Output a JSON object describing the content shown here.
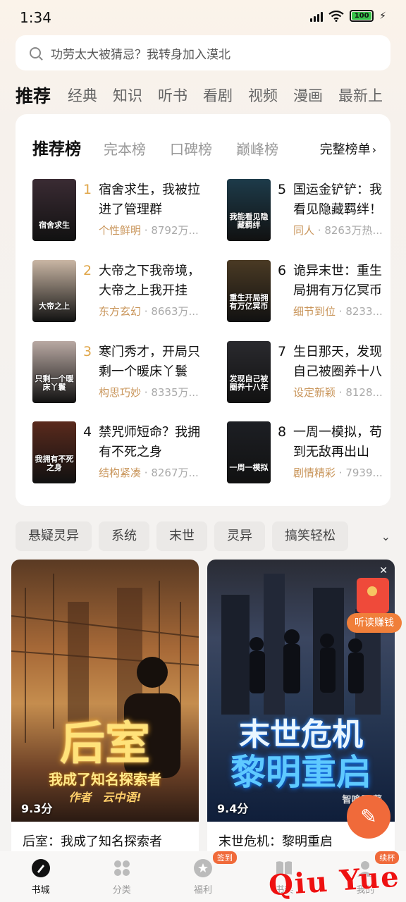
{
  "status": {
    "time": "1:34",
    "battery": "100"
  },
  "search": {
    "placeholder": "功劳太大被猜忌？我转身加入漠北"
  },
  "top_tabs": [
    "推荐",
    "经典",
    "知识",
    "听书",
    "看剧",
    "视频",
    "漫画",
    "最新上"
  ],
  "ranking": {
    "tabs": [
      "推荐榜",
      "完本榜",
      "口碑榜",
      "巅峰榜"
    ],
    "full_list": "完整榜单",
    "items": [
      {
        "rank": "1",
        "title": "宿舍求生，我被拉进了管理群",
        "tag": "个性鲜明",
        "heat": "8792万...",
        "cover": "宿舍求生",
        "color": "#3a2b33"
      },
      {
        "rank": "2",
        "title": "大帝之下我帝境，大帝之上我开挂",
        "tag": "东方玄幻",
        "heat": "8663万...",
        "cover": "大帝之上",
        "color": "#c9b6a4"
      },
      {
        "rank": "3",
        "title": "寒门秀才，开局只剩一个暖床丫鬟",
        "tag": "构思巧妙",
        "heat": "8335万...",
        "cover": "只剩一个暖床丫鬟",
        "color": "#b9a9a3"
      },
      {
        "rank": "4",
        "title": "禁咒师短命？我拥有不死之身",
        "tag": "结构紧凑",
        "heat": "8267万...",
        "cover": "我拥有不死之身",
        "color": "#5a2a1d"
      },
      {
        "rank": "5",
        "title": "国运金铲铲：我看见隐藏羁绊！",
        "tag": "同人",
        "heat": "8263万热...",
        "cover": "我能看见隐藏羁绊",
        "color": "#1d3b4a"
      },
      {
        "rank": "6",
        "title": "诡异末世：重生局拥有万亿冥币",
        "tag": "细节到位",
        "heat": "8233...",
        "cover": "重生开局拥有万亿冥币",
        "color": "#4a3a24"
      },
      {
        "rank": "7",
        "title": "生日那天，发现自己被圈养十八年",
        "tag": "设定新颖",
        "heat": "8128...",
        "cover": "发现自己被圈养十八年",
        "color": "#2a2a2e"
      },
      {
        "rank": "8",
        "title": "一周一模拟，苟到无敌再出山",
        "tag": "剧情精彩",
        "heat": "7939...",
        "cover": "一周一模拟",
        "color": "#1d1f24"
      }
    ]
  },
  "genres": [
    "悬疑灵异",
    "系统",
    "末世",
    "灵异",
    "搞笑轻松"
  ],
  "cards": [
    {
      "art": "后室",
      "art_sub": "我成了知名探索者",
      "author_art": "作者　云中语!",
      "score": "9.3分",
      "name": "后室：我成了知名探索者"
    },
    {
      "art": "末世危机",
      "art_sub": "黎明重启",
      "author_art": "智哆星 著",
      "score": "9.4分",
      "name": "末世危机：黎明重启"
    }
  ],
  "listen_badge": "听读赚钱",
  "nav": [
    {
      "label": "书城",
      "icon": "bookstore-icon"
    },
    {
      "label": "分类",
      "icon": "category-icon"
    },
    {
      "label": "福利",
      "icon": "welfare-icon",
      "badge": "签到"
    },
    {
      "label": "书架",
      "icon": "bookshelf-icon"
    },
    {
      "label": "我的",
      "icon": "profile-icon",
      "badge": "续杯"
    }
  ],
  "watermark": "Qiu Yue",
  "colors": {
    "accent": "#f06a3a",
    "tag": "#c9955a",
    "rank_gold": "#e0a648"
  }
}
